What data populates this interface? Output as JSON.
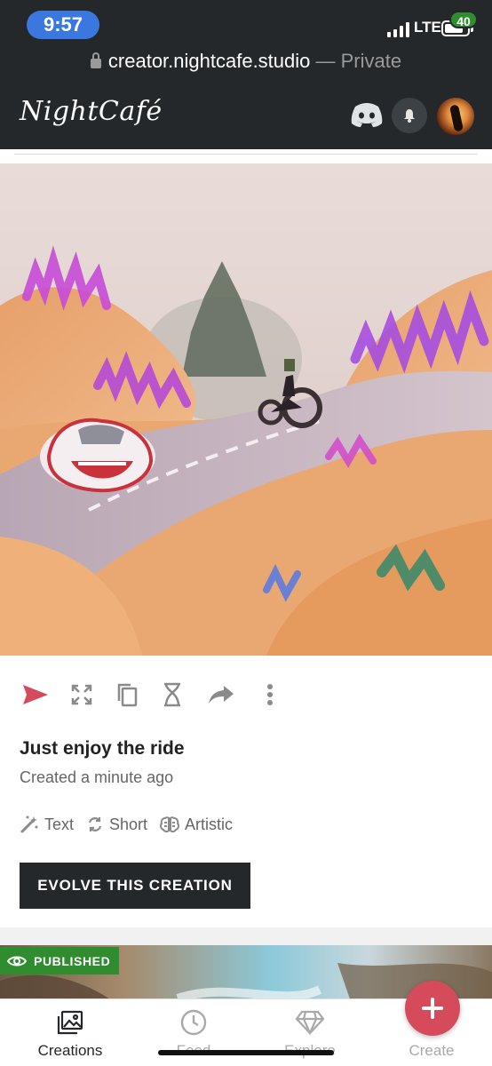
{
  "status_bar": {
    "time": "9:57",
    "network": "LTE",
    "url": "creator.nightcafe.studio",
    "url_suffix": " — Private"
  },
  "header": {
    "logo": "NightCafé",
    "notification_count": "40"
  },
  "creation": {
    "title": "Just enjoy the ride",
    "created": "Created a minute ago",
    "tags": [
      {
        "icon": "magic-wand-icon",
        "label": "Text"
      },
      {
        "icon": "refresh-icon",
        "label": "Short"
      },
      {
        "icon": "brain-icon",
        "label": "Artistic"
      }
    ],
    "evolve_label": "EVOLVE THIS CREATION",
    "actions": [
      "send-icon",
      "fullscreen-icon",
      "copy-icon",
      "hourglass-icon",
      "share-icon",
      "more-vertical-icon"
    ]
  },
  "next_card": {
    "status": "PUBLISHED"
  },
  "bottom_nav": {
    "items": [
      {
        "label": "Creations",
        "icon": "images-icon",
        "active": true
      },
      {
        "label": "Feed",
        "icon": "clock-icon",
        "active": false
      },
      {
        "label": "Explore",
        "icon": "diamond-icon",
        "active": false
      },
      {
        "label": "Create",
        "icon": "plus-icon",
        "active": false
      }
    ]
  },
  "colors": {
    "dark": "#24282b",
    "accent": "#d64b5c",
    "published": "#2f8d2f",
    "time_pill": "#3a78e0"
  }
}
